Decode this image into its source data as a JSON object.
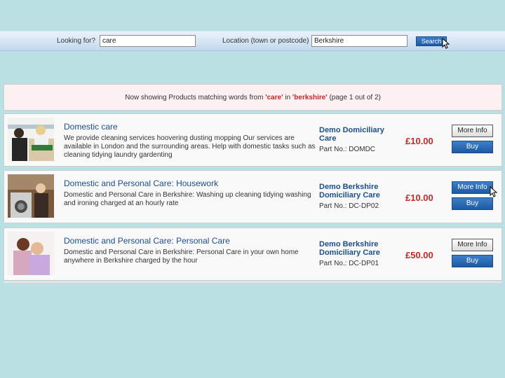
{
  "search": {
    "looking_label": "Looking for?",
    "looking_value": "care",
    "location_label": "Location (town or postcode)",
    "location_value": "Berkshire",
    "button_label": "Search"
  },
  "status": {
    "prefix": "Now showing Products matching words from ",
    "term": "'care'",
    "mid": " in ",
    "location": "'berkshire'",
    "suffix": " (page 1 out of 2)"
  },
  "products": [
    {
      "title": "Domestic care",
      "description": "We provide cleaning services hoovering dusting mopping Our services are available in London and the surrounding areas.  Help with domestic tasks such as cleaning tidying laundry gardenting",
      "supplier": "Demo Domiciliary Care",
      "part_no": "Part No.: DOMDC",
      "price": "£10.00",
      "more_label": "More Info",
      "buy_label": "Buy"
    },
    {
      "title": "Domestic and Personal Care: Housework",
      "description": "Domestic and Personal Care in Berkshire: Washing up cleaning tidying washing and ironing charged at an hourly rate",
      "supplier": "Demo Berkshire Domiciliary Care",
      "part_no": "Part No.: DC-DP02",
      "price": "£10.00",
      "more_label": "More Info",
      "buy_label": "Buy"
    },
    {
      "title": "Domestic and Personal Care: Personal Care",
      "description": "Domestic and Personal Care in Berkshire: Personal Care in your own home anywhere in Berkshire charged by the hour",
      "supplier": "Demo Berkshire Domiciliary Care",
      "part_no": "Part No.: DC-DP01",
      "price": "£50.00",
      "more_label": "More Info",
      "buy_label": "Buy"
    }
  ],
  "colors": {
    "background": "#b9e0e3",
    "link": "#1a4f8b",
    "price": "#c62828",
    "button": "#1d5aa5"
  }
}
